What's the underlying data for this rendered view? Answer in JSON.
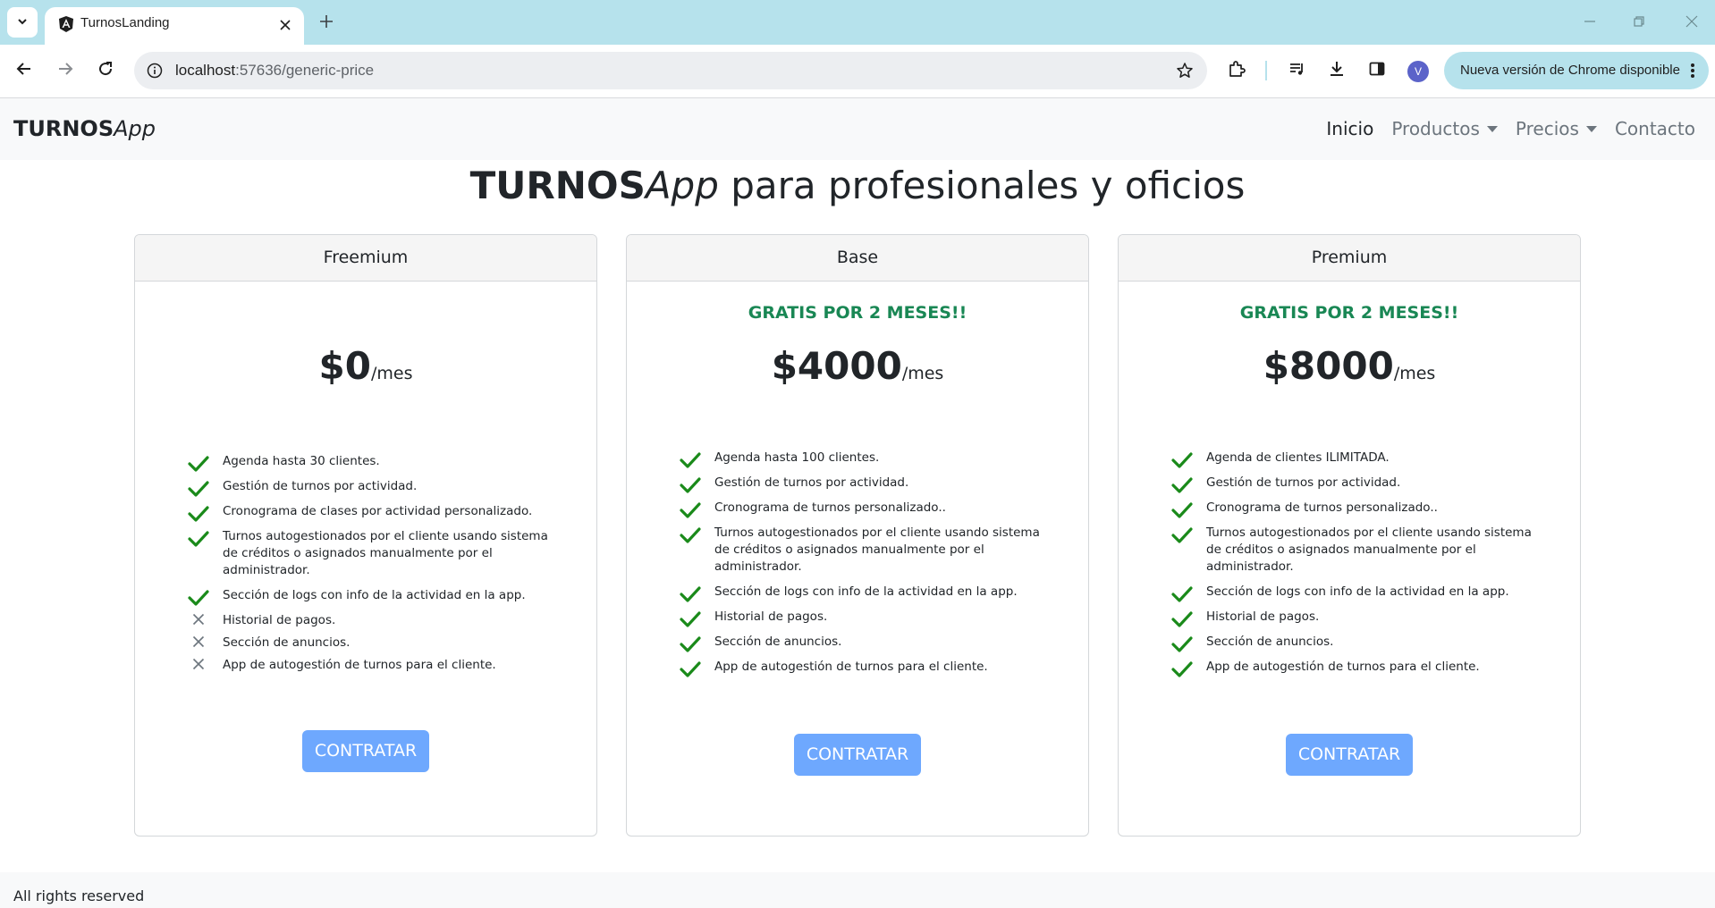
{
  "browser": {
    "tab_title": "TurnosLanding",
    "url_host": "localhost",
    "url_path": ":57636/generic-price",
    "profile_initial": "V",
    "update_label": "Nueva versión de Chrome disponible"
  },
  "navbar": {
    "brand_bold": "TURNOS",
    "brand_italic": "App",
    "links": [
      {
        "label": "Inicio",
        "active": true
      },
      {
        "label": "Productos",
        "dropdown": true
      },
      {
        "label": "Precios",
        "dropdown": true
      },
      {
        "label": "Contacto"
      }
    ]
  },
  "hero": {
    "bold": "TURNOS",
    "italic": "App",
    "rest": " para profesionales y oficios"
  },
  "colors": {
    "check": "#1a8a1a",
    "cross": "#6c757d",
    "promo": "#198754",
    "button": "#6ea8fe"
  },
  "plans": [
    {
      "name": "Freemium",
      "promo": "",
      "amount": "$0",
      "per": "/mes",
      "button": "CONTRATAR",
      "features": [
        {
          "text": "Agenda hasta 30 clientes.",
          "included": true
        },
        {
          "text": "Gestión de turnos por actividad.",
          "included": true
        },
        {
          "text": "Cronograma de clases por actividad personalizado.",
          "included": true
        },
        {
          "text": "Turnos autogestionados por el cliente usando sistema de créditos o asignados manualmente por el administrador.",
          "included": true
        },
        {
          "text": "Sección de logs con info de la actividad en la app.",
          "included": true
        },
        {
          "text": "Historial de pagos.",
          "included": false
        },
        {
          "text": "Sección de anuncios.",
          "included": false
        },
        {
          "text": "App de autogestión de turnos para el cliente.",
          "included": false
        }
      ]
    },
    {
      "name": "Base",
      "promo": "GRATIS POR 2 MESES!!",
      "amount": "$4000",
      "per": "/mes",
      "button": "CONTRATAR",
      "features": [
        {
          "text": "Agenda hasta 100 clientes.",
          "included": true
        },
        {
          "text": "Gestión de turnos por actividad.",
          "included": true
        },
        {
          "text": "Cronograma de turnos personalizado..",
          "included": true
        },
        {
          "text": "Turnos autogestionados por el cliente usando sistema de créditos o asignados manualmente por el administrador.",
          "included": true
        },
        {
          "text": "Sección de logs con info de la actividad en la app.",
          "included": true
        },
        {
          "text": "Historial de pagos.",
          "included": true
        },
        {
          "text": "Sección de anuncios.",
          "included": true
        },
        {
          "text": "App de autogestión de turnos para el cliente.",
          "included": true
        }
      ]
    },
    {
      "name": "Premium",
      "promo": "GRATIS POR 2 MESES!!",
      "amount": "$8000",
      "per": "/mes",
      "button": "CONTRATAR",
      "features": [
        {
          "text": "Agenda de clientes ILIMITADA.",
          "included": true
        },
        {
          "text": "Gestión de turnos por actividad.",
          "included": true
        },
        {
          "text": "Cronograma de turnos personalizado..",
          "included": true
        },
        {
          "text": "Turnos autogestionados por el cliente usando sistema de créditos o asignados manualmente por el administrador.",
          "included": true
        },
        {
          "text": "Sección de logs con info de la actividad en la app.",
          "included": true
        },
        {
          "text": "Historial de pagos.",
          "included": true
        },
        {
          "text": "Sección de anuncios.",
          "included": true
        },
        {
          "text": "App de autogestión de turnos para el cliente.",
          "included": true
        }
      ]
    }
  ],
  "footer": {
    "text": "All rights reserved"
  }
}
